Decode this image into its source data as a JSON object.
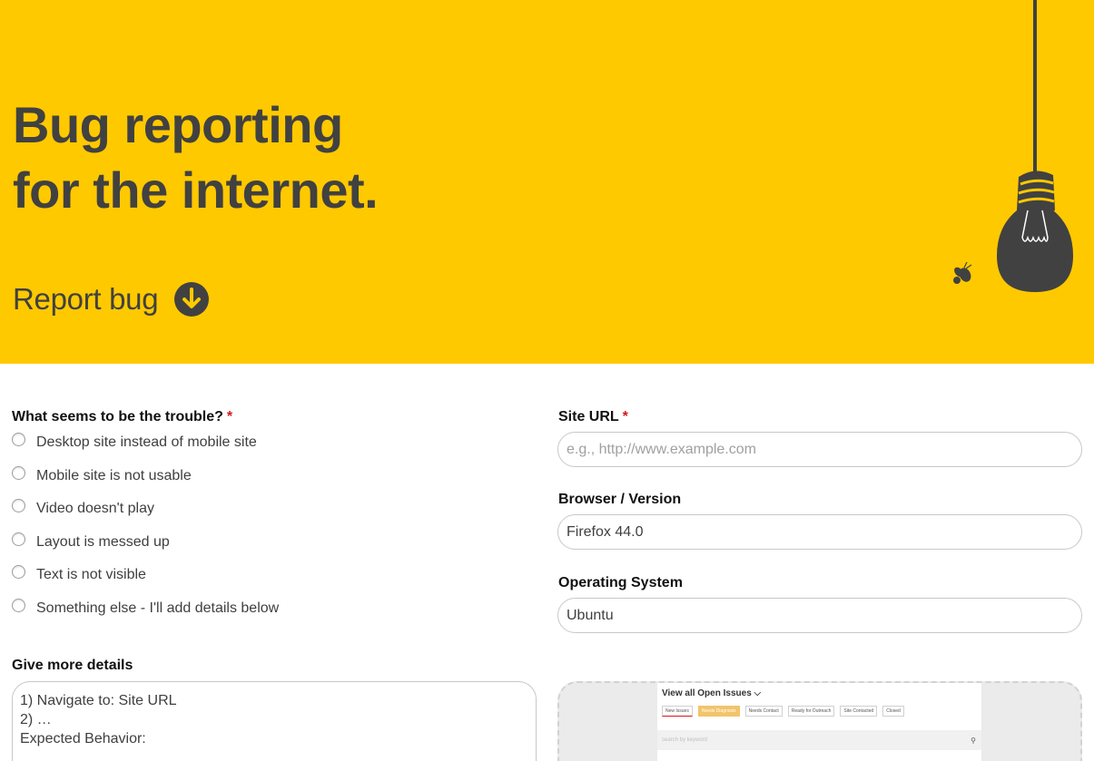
{
  "hero": {
    "title_line1": "Bug reporting",
    "title_line2": "for the internet.",
    "report_bug_label": "Report bug",
    "background_color": "#ffc900",
    "text_color": "#414141",
    "arrow_icon": "down-arrow-circle-icon",
    "illustration": "hanging-light-bulb-with-bee"
  },
  "form": {
    "trouble": {
      "label": "What seems to be the trouble?",
      "required_mark": "*",
      "options": [
        "Desktop site instead of mobile site",
        "Mobile site is not usable",
        "Video doesn't play",
        "Layout is messed up",
        "Text is not visible",
        "Something else - I'll add details below"
      ]
    },
    "site_url": {
      "label": "Site URL",
      "required_mark": "*",
      "value": "",
      "placeholder": "e.g., http://www.example.com"
    },
    "browser": {
      "label": "Browser / Version",
      "value": "Firefox 44.0"
    },
    "os": {
      "label": "Operating System",
      "value": "Ubuntu"
    },
    "details": {
      "label": "Give more details",
      "lines": [
        "1) Navigate to: Site URL",
        "2) …",
        "",
        "Expected Behavior:"
      ]
    },
    "screenshot_preview": {
      "title": "View all Open Issues",
      "tabs": [
        "New Issues",
        "Needs Diagnosis",
        "Needs Contact",
        "Ready for Outreach",
        "Site Contacted",
        "Closed"
      ],
      "search_placeholder": "search by keyword",
      "search_icon": "search-icon"
    }
  }
}
